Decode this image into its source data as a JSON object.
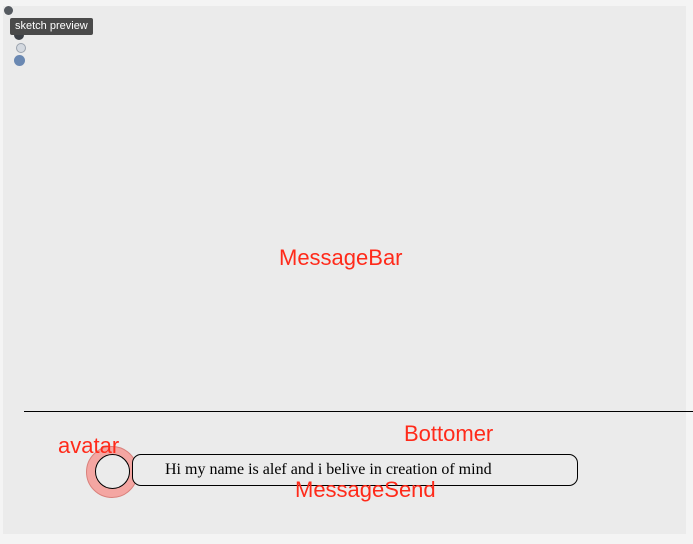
{
  "tooltip": {
    "text": "sketch preview"
  },
  "labels": {
    "message_bar": "MessageBar",
    "bottomer": "Bottomer",
    "avatar": "avatar",
    "message_send": "MessageSend"
  },
  "message": {
    "text": "Hi my name is alef and i belive in creation of mind"
  },
  "colors": {
    "canvas_background": "#ebebeb",
    "label_red": "#ff2a1a",
    "avatar_ring": "#f4a6a2",
    "tooltip_background": "#4a4a4a"
  },
  "icons": {
    "toolbar_dots": [
      "dot-icon",
      "dot-icon",
      "dot-icon",
      "dot-icon"
    ]
  }
}
